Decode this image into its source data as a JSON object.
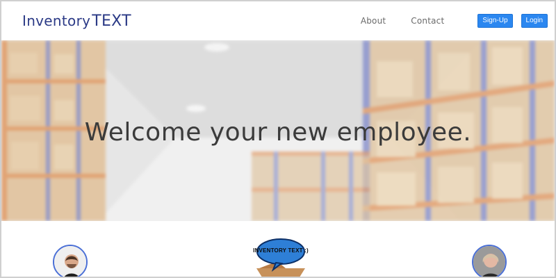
{
  "header": {
    "brand_part1": "Inventory",
    "brand_part2": "TEXT",
    "nav_links": [
      {
        "label": "About"
      },
      {
        "label": "Contact"
      }
    ],
    "buttons": {
      "signup_label": "Sign-Up",
      "login_label": "Login"
    },
    "colors": {
      "brand": "#2b3a86",
      "button_bg": "#2b87f0",
      "nav_text": "#6a6a6a"
    }
  },
  "hero": {
    "title": "Welcome your new employee."
  },
  "team": {
    "logo_text": "INVENTORY TEXT :)",
    "avatar_left_icon": "person-avatar-icon",
    "avatar_right_icon": "person-avatar-icon",
    "logo_icon": "box-speech-bubble-logo"
  }
}
